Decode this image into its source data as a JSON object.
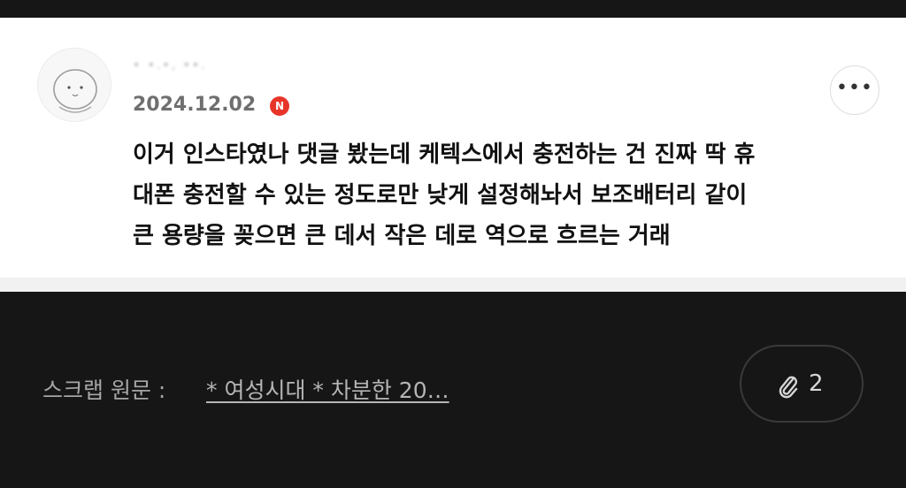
{
  "comment_card": {
    "username": "• •.•, ••.",
    "date": "2024.12.02",
    "platform_badge": "N",
    "more_label": "•••",
    "lines": [
      "이거 인스타였나 댓글 봤는데 케텍스에서 충전하는 건 진짜 딱 휴",
      "대폰 충전할 수 있는 정도로만 낮게 설정해놔서 보조배터리 같이",
      "큰 용량을 꽂으면 큰 데서 작은 데로 역으로 흐르는 거래"
    ]
  },
  "footer": {
    "source_label": "스크랩 원문 :",
    "source_link": " * 여성시대 *  차분한 20…",
    "attachment_count": "2"
  },
  "colors": {
    "background": "#161616",
    "card": "#ffffff",
    "badge": "#e8352a"
  },
  "icons": {
    "avatar": "cartoon-character-avatar",
    "more": "more-options-icon",
    "attachment": "paperclip-icon"
  }
}
